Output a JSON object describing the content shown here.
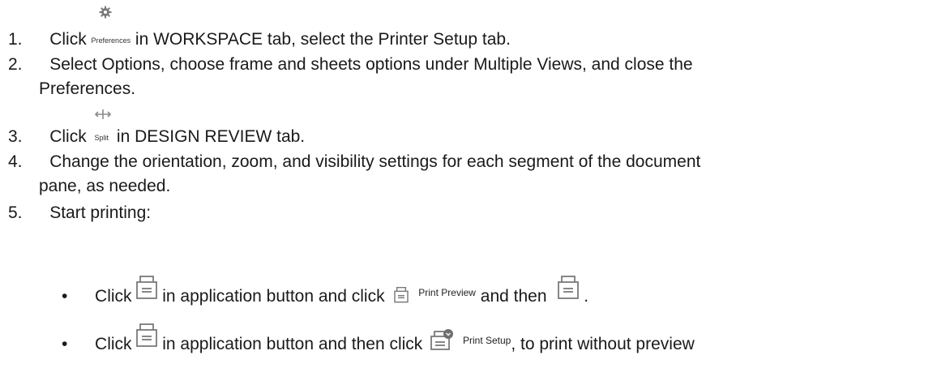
{
  "steps": [
    {
      "number": "1.",
      "click": "Click",
      "icon_label": "Preferences",
      "icon_name": "gear-icon",
      "rest": "in WORKSPACE tab, select the Printer Setup tab."
    },
    {
      "number": "2.",
      "line1": "Select Options, choose frame and sheets options under Multiple Views, and close the",
      "line2": "Preferences."
    },
    {
      "number": "3.",
      "click": "Click",
      "icon_label": "Split",
      "icon_name": "split-arrows-icon",
      "rest": "in DESIGN REVIEW tab."
    },
    {
      "number": "4.",
      "line1": "Change the orientation, zoom, and visibility settings for each segment of the document",
      "line2": "pane, as needed."
    },
    {
      "number": "5.",
      "text": "Start printing:"
    }
  ],
  "bullets": [
    {
      "marker": "•",
      "click": "Click",
      "icon1": "printer-icon",
      "mid": "in application button and click",
      "icon2": "printer-icon",
      "icon2_label": "Print Preview",
      "and_then": "and then",
      "icon3": "printer-icon",
      "end": "."
    },
    {
      "marker": "•",
      "click": "Click",
      "icon1": "printer-icon",
      "mid": "in application button and then click",
      "icon2": "printer-setup-icon",
      "icon2_label": "Print Setup",
      "end": ", to print without preview"
    }
  ],
  "colors": {
    "text": "#1a1a1a",
    "icon_gray": "#7a7a7a"
  }
}
